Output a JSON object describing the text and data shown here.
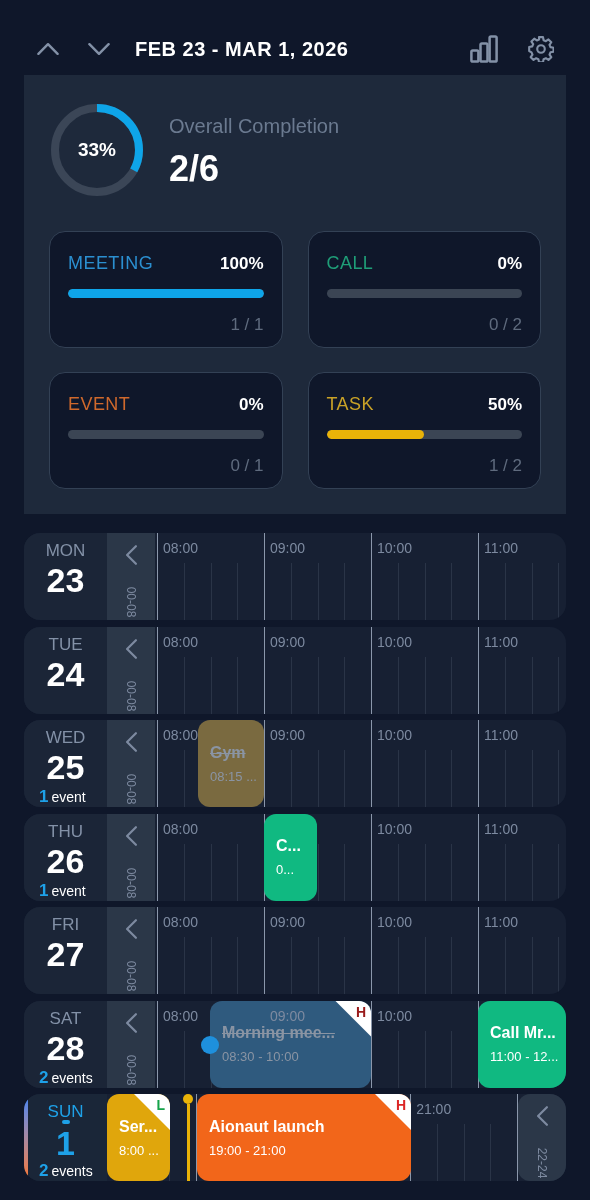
{
  "header": {
    "title": "FEB 23 - MAR 1, 2026"
  },
  "summary": {
    "percent": "33%",
    "label": "Overall Completion",
    "count": "2/6"
  },
  "categories": [
    {
      "name": "MEETING",
      "percent": "100%",
      "level": 1,
      "count": "1 / 1",
      "color": "#2b8fd0"
    },
    {
      "name": "CALL",
      "percent": "0%",
      "level": 0,
      "count": "0 / 2",
      "color": "#1f9e78"
    },
    {
      "name": "EVENT",
      "percent": "0%",
      "level": 0,
      "count": "0 / 1",
      "color": "#d0692c"
    },
    {
      "name": "TASK",
      "percent": "50%",
      "level": 0.5,
      "count": "1 / 2",
      "color": "#c9a227"
    }
  ],
  "days": [
    {
      "weekday": "MON",
      "date": "23",
      "today": false,
      "range": {
        "kind": "left",
        "label": "00-08"
      },
      "hours": [
        "08:00",
        "09:00",
        "10:00",
        "11:00"
      ]
    },
    {
      "weekday": "TUE",
      "date": "24",
      "today": false,
      "range": {
        "kind": "left",
        "label": "00-08"
      },
      "hours": [
        "08:00",
        "09:00",
        "10:00",
        "11:00"
      ]
    },
    {
      "weekday": "WED",
      "date": "25",
      "today": false,
      "event_count": "1",
      "event_label": "event",
      "range": {
        "kind": "left",
        "label": "00-08"
      },
      "hours": [
        "08:00",
        "09:00",
        "10:00",
        "11:00"
      ],
      "events": [
        {
          "title": "Gym",
          "time": "08:15 ...",
          "color": "#7a6a40",
          "done": true
        }
      ]
    },
    {
      "weekday": "THU",
      "date": "26",
      "today": false,
      "event_count": "1",
      "event_label": "event",
      "range": {
        "kind": "left",
        "label": "00-08"
      },
      "hours": [
        "08:00",
        "10:00",
        "11:00"
      ],
      "events": [
        {
          "title": "C...",
          "time": "0...",
          "color": "#10b981",
          "done": false
        }
      ]
    },
    {
      "weekday": "FRI",
      "date": "27",
      "today": false,
      "range": {
        "kind": "left",
        "label": "00-08"
      },
      "hours": [
        "08:00",
        "09:00",
        "10:00",
        "11:00"
      ]
    },
    {
      "weekday": "SAT",
      "date": "28",
      "today": false,
      "event_count": "2",
      "event_label": "events",
      "range": {
        "kind": "left",
        "label": "00-08"
      },
      "hours": [
        "08:00",
        "09:00",
        "10:00"
      ],
      "events": [
        {
          "title": "Morning mee...",
          "time": "08:30 - 10:00",
          "color": "#2f5a7e",
          "done": true,
          "reminder": true,
          "priority": {
            "label": "H",
            "color": "#991b1b"
          }
        },
        {
          "title": "Call Mr...",
          "time": "11:00 - 12...",
          "color": "#10b981",
          "done": false
        }
      ]
    },
    {
      "weekday": "SUN",
      "date": "1",
      "today": true,
      "event_count": "2",
      "event_label": "events",
      "range": {
        "kind": "right",
        "label": "22-24"
      },
      "hours": [
        "21:00"
      ],
      "events": [
        {
          "title": "Ser...",
          "time": "8:00 ...",
          "color": "#e0a60c",
          "done": false,
          "priority": {
            "label": "L",
            "color": "#16a34a"
          }
        },
        {
          "title": "Aionaut launch",
          "time": "19:00 - 21:00",
          "color": "#f2661a",
          "done": false,
          "priority": {
            "label": "H",
            "color": "#dc2626"
          }
        }
      ]
    }
  ]
}
